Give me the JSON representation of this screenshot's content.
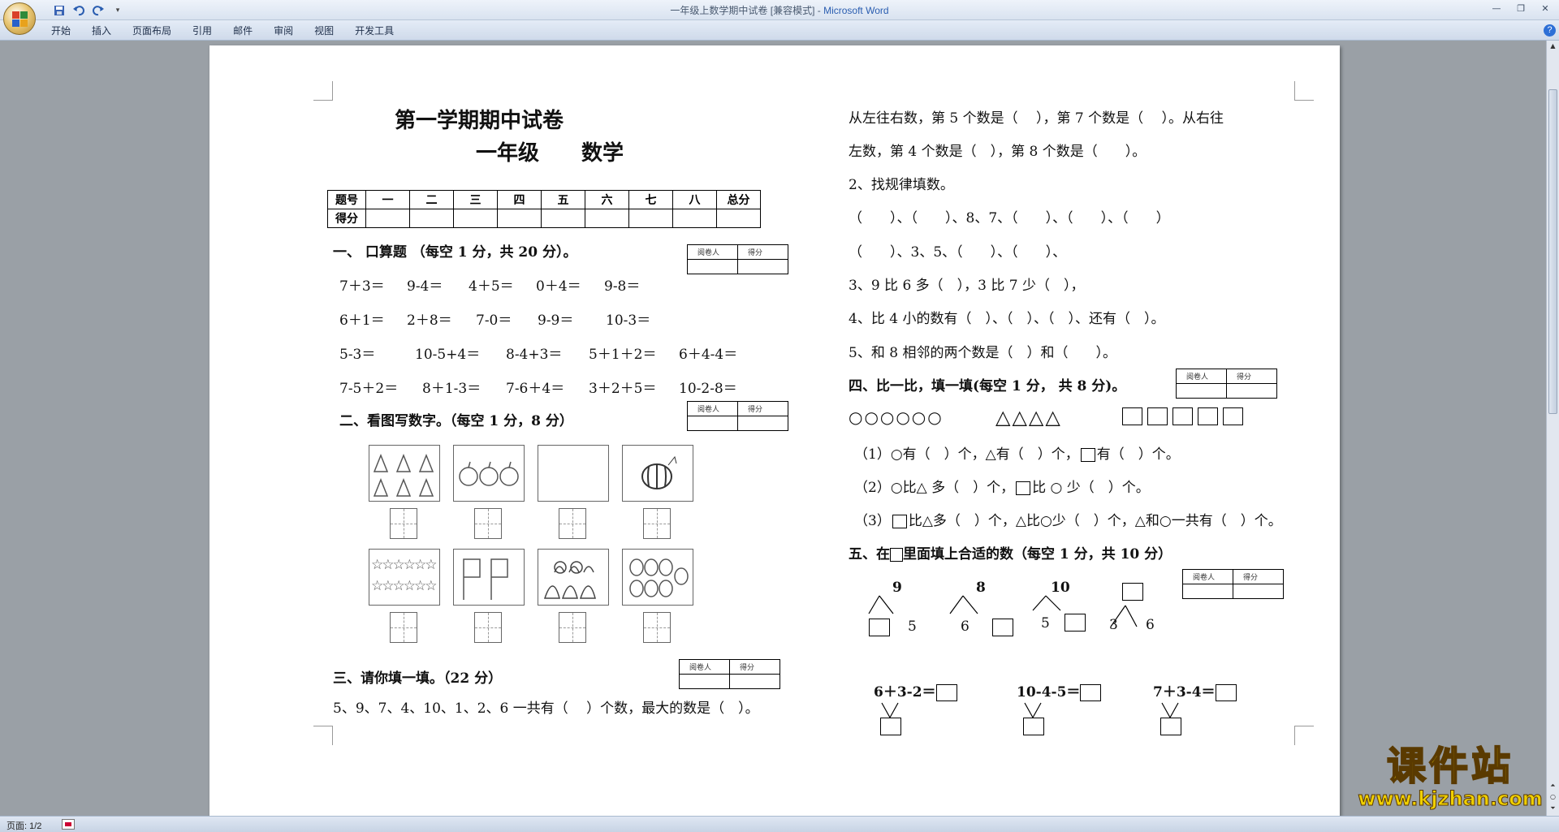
{
  "window": {
    "title": "一年级上数学期中试卷 [兼容模式] - ",
    "app": "Microsoft Word",
    "ribbon_tabs": [
      "开始",
      "插入",
      "页面布局",
      "引用",
      "邮件",
      "审阅",
      "视图",
      "开发工具"
    ]
  },
  "status_bar": {
    "page": "页面: 1/2"
  },
  "watermark": {
    "main": "课件站",
    "url": "www.kjzhan.com"
  },
  "doc": {
    "title": "第一学期期中试卷",
    "subtitle": "一年级　　数学",
    "score_table": {
      "row1": [
        "题号",
        "一",
        "二",
        "三",
        "四",
        "五",
        "六",
        "七",
        "八",
        "总分"
      ],
      "row2_label": "得分"
    },
    "grader": {
      "reviewer": "阅卷人",
      "score": "得分"
    },
    "section1": {
      "heading": "一、 口算题  （每空 1 分，共 20 分）。",
      "rows": [
        [
          "7＋3＝",
          "9-4＝",
          "4＋5＝",
          "0＋4＝",
          "9-8＝"
        ],
        [
          "6＋1＝",
          "2＋8＝",
          "7-0＝",
          "9-9＝",
          "10-3＝"
        ],
        [
          "5-3＝",
          "10-5+4＝",
          "8-4+3＝",
          "5＋1＋2＝",
          "6＋4-4＝"
        ],
        [
          "7-5＋2＝",
          "8＋1-3＝",
          "7-6＋4＝",
          "3＋2＋5＝",
          "10-2-8＝"
        ]
      ]
    },
    "section2": {
      "heading": "二、看图写数字。（每空 1 分，8 分）"
    },
    "section3": {
      "heading": "三、请你填一填。（22 分）",
      "q1": "5、9、7、4、10、1、2、6 一共有（　 ）个数，最大的数是（　）。",
      "q1_cont1": "从左往右数，第 5 个数是（　 ），第 7 个数是（　 ）。从右往",
      "q1_cont2": "左数，第 4 个数是（　），第 8 个数是（　　）。",
      "q2": "2、找规律填数。",
      "q2_row1": "（　　）、（　　）、8、7、（　　）、（　　）、（　　）",
      "q2_row2": "（　　）、3、5、（　　）、（　　）、",
      "q3": "3、9 比 6 多（　），3 比 7 少（　），",
      "q4": "4、比 4 小的数有（　）、（　）、（　）、还有（　）。",
      "q5": "5、和 8 相邻的两个数是（　）和（　　）。"
    },
    "section4": {
      "heading": "四、比一比，填一填(每空 1 分， 共 8 分)。",
      "circles": "○○○○○○",
      "triangles": "△△△△",
      "l1": "（1）○有（　）个，△有（　）个，",
      "l1b": "有（　）个。",
      "l2": "（2）○比△ 多（　）个，",
      "l2b": "比 ○ 少（　）个。",
      "l3a": "（3）",
      "l3b": "比△多（　）个，△比○少（　）个，△和○一共有（　）个。"
    },
    "section5": {
      "heading_a": "五、在",
      "heading_b": "里面填上合适的数（每空 1 分，共 10 分）",
      "trees": [
        {
          "top": "9",
          "right": "5"
        },
        {
          "top": "8",
          "left": "6"
        },
        {
          "top": "10",
          "left": "5"
        },
        {
          "left": "3",
          "right": "6"
        }
      ],
      "eqs": [
        "6＋3-2＝",
        "10-4-5＝",
        "7＋3-4＝"
      ]
    }
  }
}
